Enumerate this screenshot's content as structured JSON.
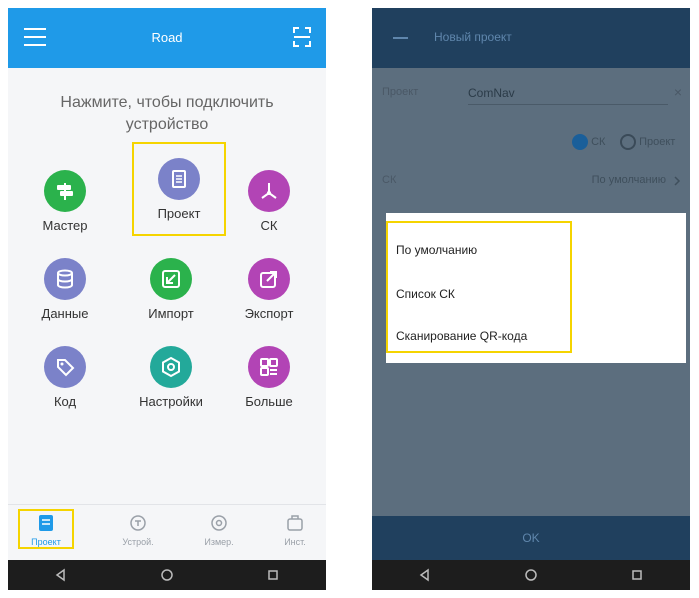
{
  "left_phone": {
    "header": {
      "title": "Road"
    },
    "prompt": "Нажмите, чтобы подключить устройство",
    "grid": [
      {
        "label": "Мастер",
        "icon": "signpost-icon",
        "color": "#2bb24c"
      },
      {
        "label": "Проект",
        "icon": "project-icon",
        "color": "#7b82c9",
        "highlighted": true
      },
      {
        "label": "СК",
        "icon": "coordinate-system-icon",
        "color": "#b244b5"
      },
      {
        "label": "Данные",
        "icon": "database-icon",
        "color": "#7b82c9"
      },
      {
        "label": "Импорт",
        "icon": "import-icon",
        "color": "#2bb24c"
      },
      {
        "label": "Экспорт",
        "icon": "export-icon",
        "color": "#b244b5"
      },
      {
        "label": "Код",
        "icon": "tag-icon",
        "color": "#7b82c9"
      },
      {
        "label": "Настройки",
        "icon": "settings-icon",
        "color": "#23a99a"
      },
      {
        "label": "Больше",
        "icon": "more-icon",
        "color": "#b244b5"
      }
    ],
    "bottom_nav": [
      {
        "label": "Проект",
        "icon": "project-icon",
        "active": true
      },
      {
        "label": "Устрой.",
        "icon": "device-icon"
      },
      {
        "label": "Измер.",
        "icon": "survey-icon"
      },
      {
        "label": "Инст.",
        "icon": "tools-icon"
      }
    ]
  },
  "right_phone": {
    "header": {
      "title": "Новый проект"
    },
    "form": {
      "name_label": "Проект",
      "name_value": "ComNav",
      "clear_glyph": "×",
      "radio_option_1": "СК",
      "radio_option_2": "Проект",
      "cs_label": "СК",
      "cs_value": "По умолчанию"
    },
    "dialog_options": [
      "По умолчанию",
      "Список СК",
      "Сканирование QR-кода"
    ],
    "ok_label": "OK"
  },
  "colors": {
    "primary": "#1f9ae8",
    "highlight": "#f5d400",
    "dark_header": "#20405e"
  }
}
